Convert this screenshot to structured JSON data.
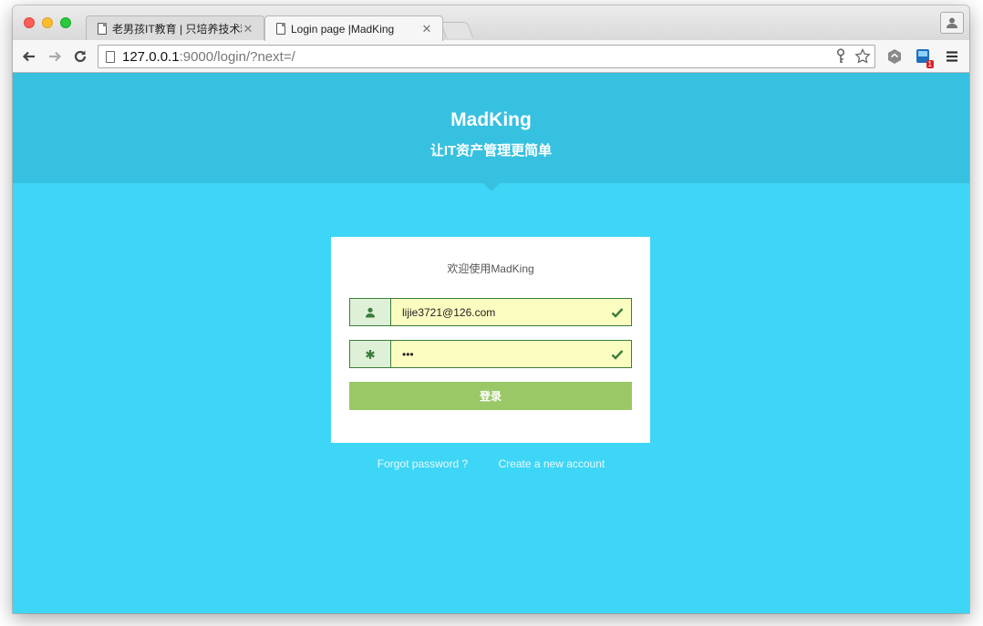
{
  "browser": {
    "tabs": [
      {
        "title": "老男孩IT教育 | 只培养技术精",
        "active": false
      },
      {
        "title": "Login page |MadKing",
        "active": true
      }
    ],
    "url_host": "127.0.0.1",
    "url_rest": ":9000/login/?next=/",
    "extension_badge": "1"
  },
  "hero": {
    "title": "MadKing",
    "subtitle": "让IT资产管理更简单"
  },
  "login_card": {
    "welcome": "欢迎使用MadKing",
    "username_value": "lijie3721@126.com",
    "password_value": "•••",
    "submit_label": "登录"
  },
  "links": {
    "forgot": "Forgot password ?",
    "create": "Create a new account"
  },
  "colors": {
    "page_bg": "#3ed6f7",
    "hero_bg": "#37c1e0",
    "button_bg": "#9ac866",
    "input_bg": "#fbfcc0",
    "addon_bg": "#dff0d8",
    "border_green": "#3b7d3b"
  }
}
